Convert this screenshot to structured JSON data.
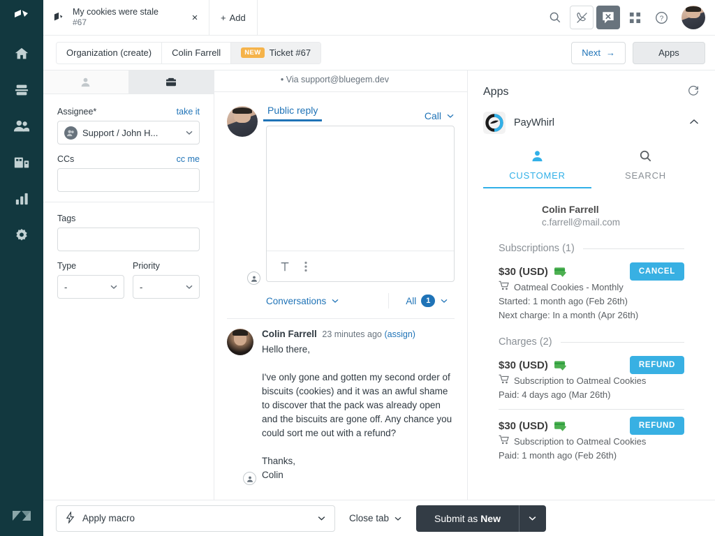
{
  "colors": {
    "rail_bg": "#12383f",
    "accent_blue": "#1f73b7",
    "app_accent": "#38b0e3",
    "badge_new": "#f5b34a",
    "submit_dark": "#333c45",
    "card_green": "#4caf50"
  },
  "rail": {
    "items": [
      {
        "name": "home-icon",
        "label": "Home"
      },
      {
        "name": "views-icon",
        "label": "Views"
      },
      {
        "name": "customers-icon",
        "label": "Customers"
      },
      {
        "name": "organizations-icon",
        "label": "Organizations"
      },
      {
        "name": "reporting-icon",
        "label": "Reporting"
      },
      {
        "name": "admin-icon",
        "label": "Admin"
      }
    ]
  },
  "topbar": {
    "tab": {
      "title": "My cookies were stale",
      "subtitle": "#67",
      "close": "×"
    },
    "add_label": "Add",
    "add_plus": "+",
    "icons": [
      {
        "name": "search-icon"
      },
      {
        "name": "phone-icon"
      },
      {
        "name": "chat-offline-icon"
      },
      {
        "name": "apps-grid-icon"
      },
      {
        "name": "help-icon"
      }
    ]
  },
  "subbar": {
    "crumbs": [
      {
        "label": "Organization (create)",
        "badge": ""
      },
      {
        "label": "Colin Farrell",
        "badge": ""
      },
      {
        "label": "Ticket #67",
        "badge": "NEW"
      }
    ],
    "next_label": "Next",
    "next_arrow": "→",
    "apps_label": "Apps"
  },
  "properties": {
    "tabs": [
      {
        "name": "user-tab",
        "icon": "user-icon",
        "active": false
      },
      {
        "name": "ticket-tab",
        "icon": "ticket-icon",
        "active": true
      }
    ],
    "assignee": {
      "label": "Assignee*",
      "action": "take it",
      "value": "Support / John H..."
    },
    "ccs": {
      "label": "CCs",
      "action": "cc me",
      "value": ""
    },
    "tags": {
      "label": "Tags",
      "value": ""
    },
    "type": {
      "label": "Type",
      "value": "-"
    },
    "priority": {
      "label": "Priority",
      "value": "-"
    }
  },
  "conversation": {
    "via": "• Via support@bluegem.dev",
    "composer": {
      "public_reply_tab": "Public reply",
      "channel_label": "Call",
      "body": "",
      "tools": [
        {
          "name": "text-format-icon",
          "glyph": "T"
        },
        {
          "name": "more-options-icon",
          "glyph": "⋮"
        }
      ]
    },
    "filters": {
      "conversations_label": "Conversations",
      "all_label": "All",
      "all_count": "1"
    },
    "comment": {
      "author": "Colin Farrell",
      "time": "23 minutes ago",
      "assign": "(assign)",
      "body": "Hello there,\n\nI've only gone and gotten my second order of biscuits (cookies) and it was an awful shame to discover that the pack was already open and the biscuits are gone off. Any chance you could sort me out with a refund?\n\nThanks,\nColin"
    }
  },
  "apps": {
    "title": "Apps",
    "refresh_icon": "refresh-icon",
    "app": {
      "name": "PayWhirl",
      "collapse_icon": "chevron-up-icon",
      "tabs": [
        {
          "label": "CUSTOMER",
          "icon": "person-icon",
          "active": true
        },
        {
          "label": "SEARCH",
          "icon": "search-icon",
          "active": false
        }
      ],
      "customer": {
        "name": "Colin Farrell",
        "email": "c.farrell@mail.com"
      },
      "sections": [
        {
          "title": "Subscriptions (1)",
          "items": [
            {
              "amount": "$30 (USD)",
              "button": "CANCEL",
              "product": "Oatmeal Cookies - Monthly",
              "lines": [
                "Started: 1 month ago (Feb 26th)",
                "Next charge: In a month (Apr 26th)"
              ]
            }
          ]
        },
        {
          "title": "Charges (2)",
          "items": [
            {
              "amount": "$30 (USD)",
              "button": "REFUND",
              "product": "Subscription to Oatmeal Cookies",
              "lines": [
                "Paid: 4 days ago (Mar 26th)"
              ]
            },
            {
              "amount": "$30 (USD)",
              "button": "REFUND",
              "product": "Subscription to Oatmeal Cookies",
              "lines": [
                "Paid: 1 month ago (Feb 26th)"
              ]
            }
          ]
        }
      ]
    }
  },
  "footer": {
    "macro_label": "Apply macro",
    "close_tab_label": "Close tab",
    "submit_prefix": "Submit as ",
    "submit_state": "New"
  }
}
